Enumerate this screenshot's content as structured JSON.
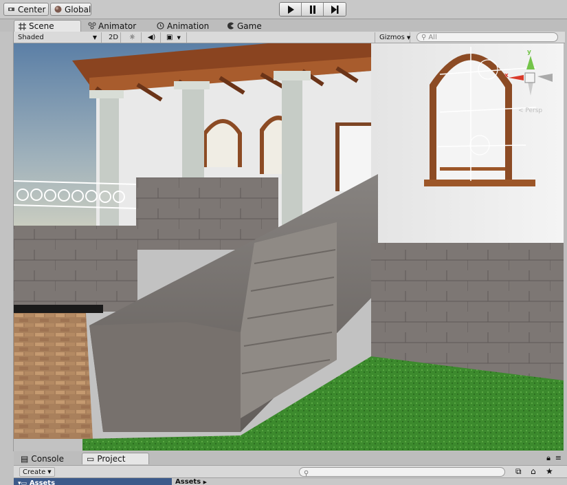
{
  "toolbar": {
    "pivot_label": "Center",
    "space_label": "Global",
    "play_icon": "play-icon",
    "pause_icon": "pause-icon",
    "step_icon": "step-icon"
  },
  "tabs": [
    {
      "label": "Scene",
      "icon": "grid-icon",
      "active": true
    },
    {
      "label": "Animator",
      "icon": "animator-icon",
      "active": false
    },
    {
      "label": "Animation",
      "icon": "clock-icon",
      "active": false
    },
    {
      "label": "Game",
      "icon": "pacman-icon",
      "active": false
    }
  ],
  "scene_controls": {
    "shading_mode": "Shaded",
    "mode_2d": "2D",
    "gizmos_label": "Gizmos",
    "search_placeholder": "All"
  },
  "scene_gizmo": {
    "y_label": "y",
    "x_label": "x",
    "projection_label": "< Persp"
  },
  "bottom": {
    "tabs": [
      {
        "label": "Console",
        "icon": "console-icon",
        "active": false
      },
      {
        "label": "Project",
        "icon": "folder-icon",
        "active": true
      }
    ],
    "create_label": "Create",
    "assets_tree_label": "Assets",
    "assets_breadcrumb": "Assets"
  },
  "colors": {
    "sky_top": "#5b7fa6",
    "sky_bottom": "#d8d6c2",
    "grass": "#3c8a2d",
    "stone": "#7a7470",
    "wall_white": "#eeeeee",
    "wood": "#8a4420",
    "gizmo_y": "#74c44a",
    "gizmo_x": "#d93a2a"
  }
}
